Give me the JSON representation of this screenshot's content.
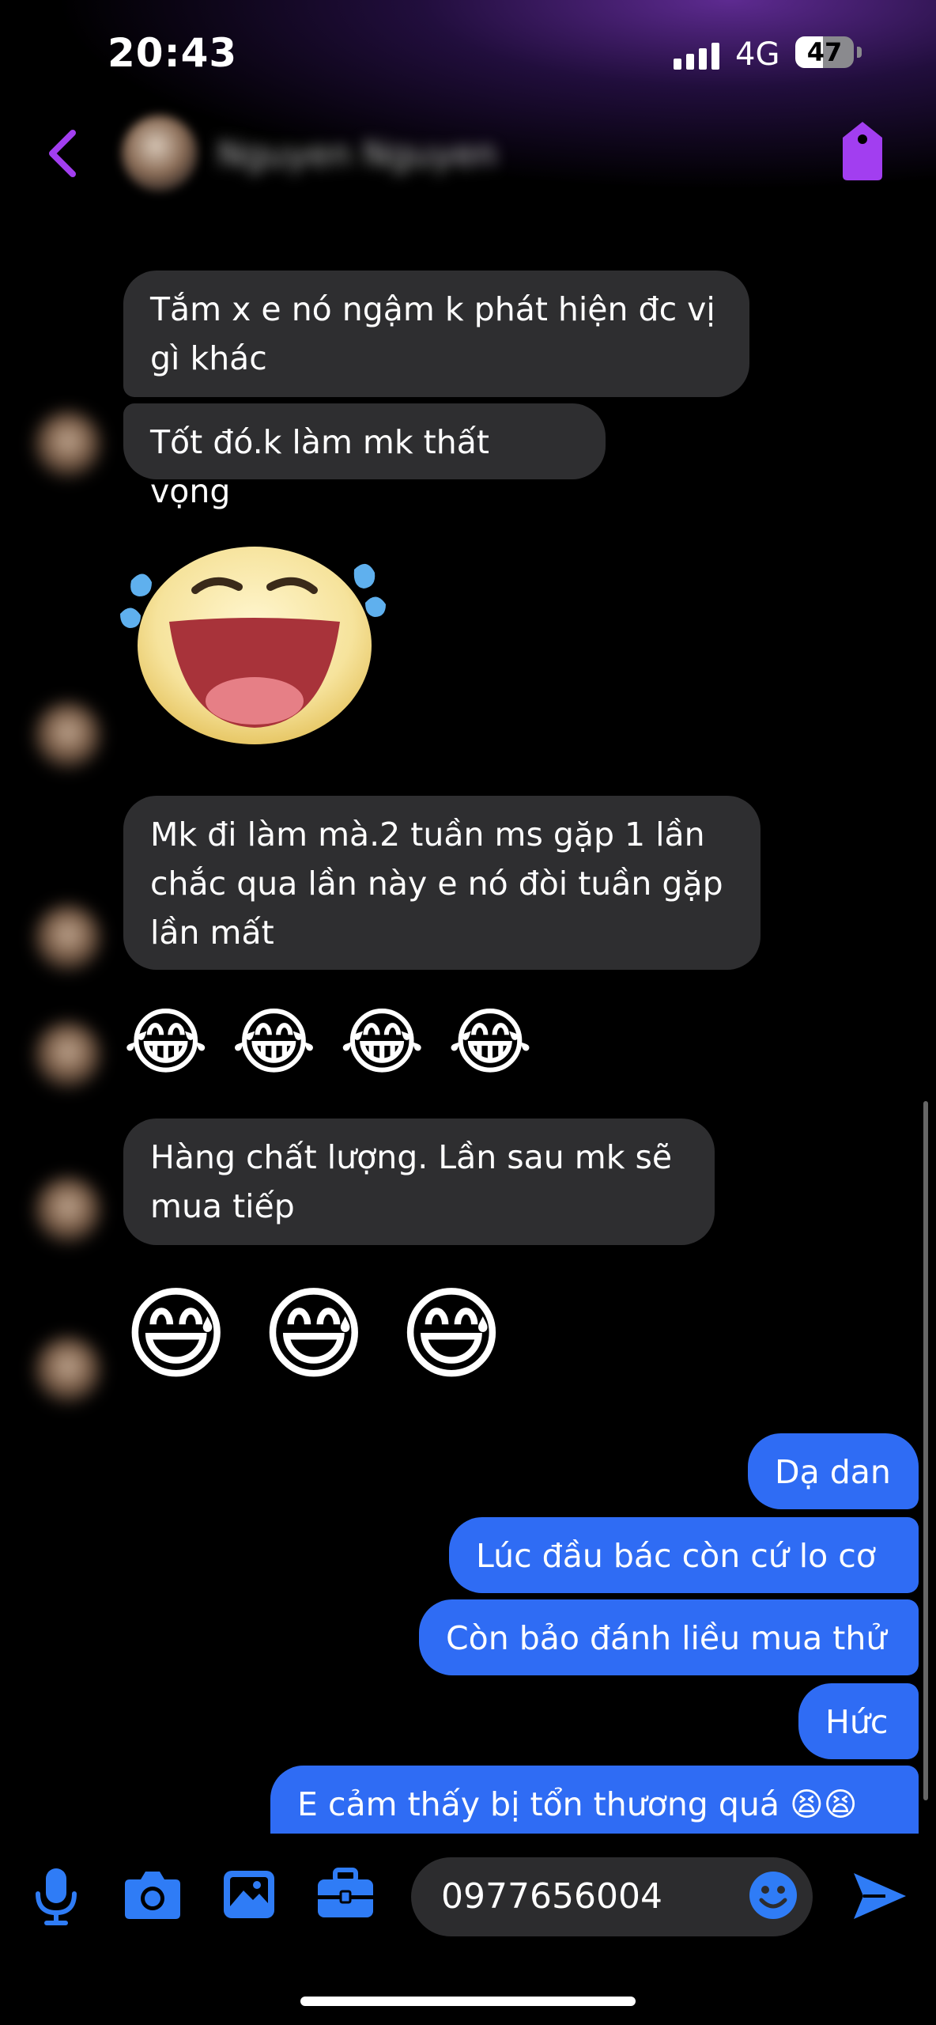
{
  "status_bar": {
    "time": "20:43",
    "network": "4G",
    "battery": "47",
    "battery_level_percent": 47
  },
  "header": {
    "contact_name": "Nguyen Nguyen"
  },
  "messages": [
    {
      "from": "them",
      "text": "Tắm x e nó ngậm k phát hiện đc vị gì khác"
    },
    {
      "from": "them",
      "text": "Tốt đó.k làm mk thất vọng"
    },
    {
      "from": "them",
      "emoji": "😆"
    },
    {
      "from": "them",
      "text": "Mk đi làm mà.2 tuần ms gặp 1 lần chắc qua lần này e nó đòi tuần gặp lần mất"
    },
    {
      "from": "them",
      "emoji": "😂 😂 😂 😂"
    },
    {
      "from": "them",
      "text": "Hàng chất lượng. Lần sau mk sẽ mua tiếp"
    },
    {
      "from": "them",
      "emoji": "😅 😅 😅"
    },
    {
      "from": "me",
      "text": "Dạ dan"
    },
    {
      "from": "me",
      "text": "Lúc đầu bác còn cứ lo cơ"
    },
    {
      "from": "me",
      "text": "Còn bảo đánh liều mua thử"
    },
    {
      "from": "me",
      "text": "Hức"
    },
    {
      "from": "me",
      "text": "E cảm thấy bị tổn thương quá 😫😫"
    }
  ],
  "composer": {
    "input_value": "0977656004"
  },
  "icons": [
    "back-chevron-icon",
    "tag-icon",
    "microphone-icon",
    "camera-icon",
    "photo-icon",
    "briefcase-icon",
    "smiley-icon",
    "send-icon"
  ],
  "colors": {
    "accent_purple": "#a23ef0",
    "outgoing_bubble": "#2f6cf4",
    "incoming_bubble": "#2e2e30",
    "toolbar_blue": "#2f7cf6"
  }
}
